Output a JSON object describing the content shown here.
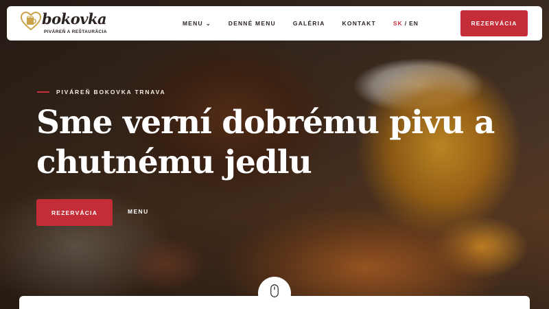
{
  "brand": {
    "name": "bokovka",
    "tagline": "PIVÁREŇ A REŠTAURÁCIA",
    "icon": "heart-beer-logo-icon"
  },
  "nav": {
    "items": [
      {
        "label": "MENU",
        "has_dropdown": true
      },
      {
        "label": "DENNÉ MENU"
      },
      {
        "label": "GALÉRIA"
      },
      {
        "label": "KONTAKT"
      }
    ],
    "lang": {
      "active": "SK",
      "separator": "/",
      "other": "EN"
    },
    "reserve_button": "REZERVÁCIA"
  },
  "hero": {
    "eyebrow": "PIVÁREŇ BOKOVKA TRNAVA",
    "headline_line1": "Sme verní dobrému pivu a",
    "headline_line2": "chutnému jedlu",
    "reserve_button": "REZERVÁCIA",
    "menu_link": "MENU"
  },
  "scroll_indicator": {
    "icon": "mouse-scroll-icon"
  },
  "colors": {
    "accent": "#c42c37",
    "text_dark": "#2c2320",
    "white": "#ffffff"
  }
}
